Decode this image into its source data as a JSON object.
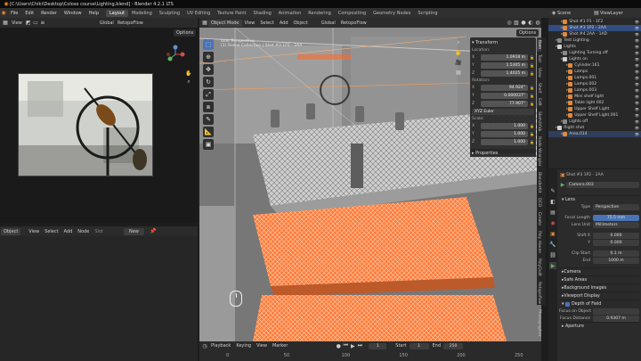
{
  "window": {
    "title": "[C:\\Users\\Chiki\\Desktop\\Coloso course\\Lighting.blend] - Blender 4.2.1 LTS"
  },
  "menu": {
    "items": [
      "File",
      "Edit",
      "Render",
      "Window",
      "Help"
    ]
  },
  "workspaces": [
    "Layout",
    "Modeling",
    "Sculpting",
    "UV Editing",
    "Texture Paint",
    "Shading",
    "Animation",
    "Rendering",
    "Compositing",
    "Geometry Nodes",
    "Scripting"
  ],
  "workspace_active": "Layout",
  "scene": {
    "label": "Scene",
    "view_layer": "ViewLayer"
  },
  "left_top": {
    "view_label": "View",
    "view_btn": "View",
    "slot": "Slot",
    "transform": "Global",
    "retopo": "RetopoFlow",
    "options": "Options"
  },
  "left_bottom": {
    "mode": "Object",
    "view": "View",
    "select": "Select",
    "add": "Add",
    "node": "Node",
    "slot": "Slot",
    "new": "New"
  },
  "viewport": {
    "mode": "Object Mode",
    "view": "View",
    "select": "Select",
    "add": "Add",
    "object": "Object",
    "transform": "Global",
    "retopo": "RetopoFlow",
    "options": "Options",
    "overlay_line1": "User Perspective",
    "overlay_line2": "(1) Scene Collection | Shot #3 1P2 - 2AA"
  },
  "transform_panel": {
    "title": "Transform",
    "location_label": "Location:",
    "location": [
      {
        "axis": "X",
        "value": "1.0918 m"
      },
      {
        "axis": "Y",
        "value": "1.5305 m"
      },
      {
        "axis": "Z",
        "value": "1.4025 m"
      }
    ],
    "rotation_label": "Rotation:",
    "rotation": [
      {
        "axis": "X",
        "value": "94.924°"
      },
      {
        "axis": "Y",
        "value": "0.000037°"
      },
      {
        "axis": "Z",
        "value": "77.907°"
      }
    ],
    "rotation_mode": "XYZ Euler",
    "scale_label": "Scale:",
    "scale": [
      {
        "axis": "X",
        "value": "1.000"
      },
      {
        "axis": "Y",
        "value": "1.000"
      },
      {
        "axis": "Z",
        "value": "1.000"
      }
    ],
    "properties": "Properties"
  },
  "side_tabs": [
    "Item",
    "Tool",
    "View",
    "Shelf",
    "Edit",
    "Sketchfab",
    "Node Wrangler",
    "BlenderKit",
    "QCD",
    "Create",
    "Poly Haven",
    "PolyQuilt",
    "Retopoflow",
    "Photographer"
  ],
  "timeline": {
    "playback": "Playback",
    "keying": "Keying",
    "view": "View",
    "marker": "Marker",
    "start_label": "Start",
    "start": "1",
    "end_label": "End",
    "end": "250",
    "current": "1",
    "ticks": [
      "0",
      "50",
      "100",
      "150",
      "200",
      "250"
    ]
  },
  "outliner": {
    "rows": [
      {
        "label": "Shot #1 P1 - 1F2",
        "indent": 2,
        "state": "normal",
        "color": "#e08a3c"
      },
      {
        "label": "Shot #3 1P2 - 2AA",
        "indent": 2,
        "state": "selected",
        "color": "#e08a3c"
      },
      {
        "label": "Shot #4 2AA - 1AD",
        "indent": 2,
        "state": "normal",
        "color": "#e08a3c"
      },
      {
        "label": "Test Lighting",
        "indent": 1,
        "state": "normal",
        "color": "#8a8a8a"
      },
      {
        "label": "Lights",
        "indent": 1,
        "state": "normal",
        "color": "#d0d0d0"
      },
      {
        "label": "Lighting Turning off",
        "indent": 2,
        "state": "normal",
        "color": "#8a8a8a"
      },
      {
        "label": "Lights on",
        "indent": 2,
        "state": "normal",
        "color": "#d0d0d0"
      },
      {
        "label": "Cylinder.161",
        "indent": 3,
        "state": "normal",
        "color": "#e08a3c"
      },
      {
        "label": "Lamps",
        "indent": 3,
        "state": "normal",
        "color": "#e08a3c"
      },
      {
        "label": "Lamps.001",
        "indent": 3,
        "state": "normal",
        "color": "#e08a3c"
      },
      {
        "label": "Lamps.002",
        "indent": 3,
        "state": "normal",
        "color": "#e08a3c"
      },
      {
        "label": "Lamps.003",
        "indent": 3,
        "state": "normal",
        "color": "#e08a3c"
      },
      {
        "label": "Mini shelf light",
        "indent": 3,
        "state": "normal",
        "color": "#e08a3c"
      },
      {
        "label": "Table light 002",
        "indent": 3,
        "state": "normal",
        "color": "#e08a3c"
      },
      {
        "label": "Upper Shelf Light",
        "indent": 3,
        "state": "normal",
        "color": "#e08a3c"
      },
      {
        "label": "Upper Shelf Light.001",
        "indent": 3,
        "state": "normal",
        "color": "#e08a3c"
      },
      {
        "label": "Lights off",
        "indent": 2,
        "state": "normal",
        "color": "#8a8a8a"
      },
      {
        "label": "Right shot",
        "indent": 1,
        "state": "normal",
        "color": "#d0d0d0"
      },
      {
        "label": "Area.014",
        "indent": 2,
        "state": "highlight",
        "color": "#e08a3c"
      }
    ]
  },
  "properties": {
    "breadcrumb": "Shot #3 1P2 - 2AA",
    "camera_name": "Camera.003",
    "lens_section": "Lens",
    "type_label": "Type",
    "type_value": "Perspective",
    "focal_label": "Focal Length",
    "focal_value": "75.5 mm",
    "lens_unit_label": "Lens Unit",
    "lens_unit_value": "Millimeters",
    "shift_x_label": "Shift X",
    "shift_x_value": "0.000",
    "shift_y_label": "Y",
    "shift_y_value": "0.000",
    "clip_start_label": "Clip Start",
    "clip_start_value": "0.1 m",
    "clip_end_label": "End",
    "clip_end_value": "1000 m",
    "sections": [
      "Camera",
      "Safe Areas",
      "Background Images",
      "Viewport Display"
    ],
    "dof_label": "Depth of Field",
    "focus_object_label": "Focus on Object",
    "focus_distance_label": "Focus Distance",
    "focus_distance_value": "0.9307 m",
    "aperture_label": "Aperture"
  },
  "colors": {
    "accent": "#4a73b5",
    "select_orange": "#ff6a2a",
    "selected_row": "#334d80"
  }
}
